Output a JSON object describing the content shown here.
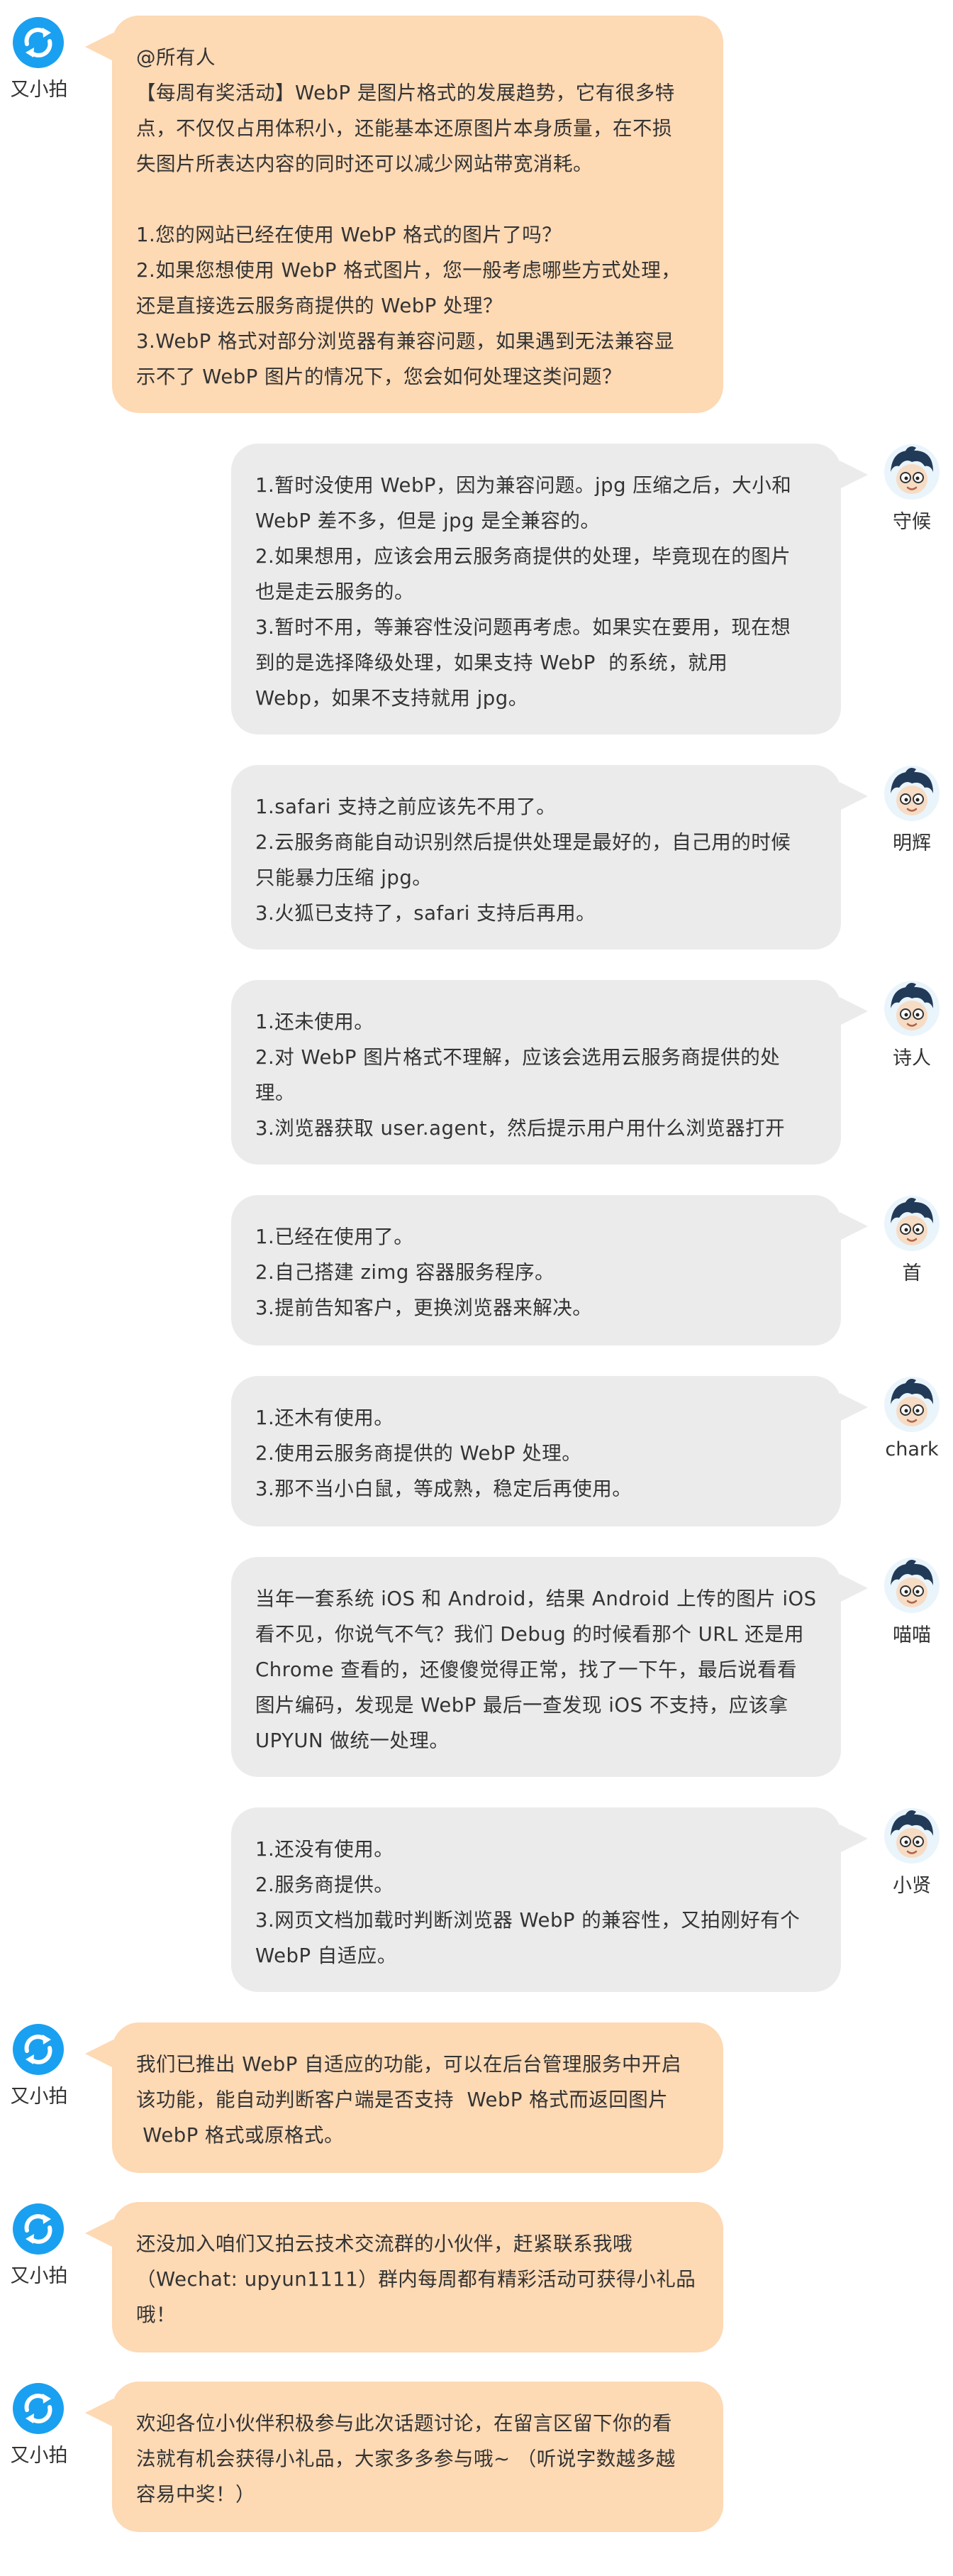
{
  "messages": [
    {
      "side": "left",
      "name": "又小拍",
      "avatar": "upyun-logo",
      "lines": [
        "@所有人",
        "【每周有奖活动】WebP 是图片格式的发展趋势，它有很多特",
        "点，不仅仅占用体积小，还能基本还原图片本身质量，在不损",
        "失图片所表达内容的同时还可以减少网站带宽消耗。",
        "",
        "1.您的网站已经在使用 WebP 格式的图片了吗？",
        "2.如果您想使用 WebP 格式图片，您一般考虑哪些方式处理，",
        "还是直接选云服务商提供的 WebP 处理？",
        "3.WebP 格式对部分浏览器有兼容问题，如果遇到无法兼容显",
        "示不了 WebP 图片的情况下，您会如何处理这类问题？"
      ]
    },
    {
      "side": "right",
      "name": "守候",
      "avatar": "cartoon-boy-avatar",
      "lines": [
        "1.暂时没使用 WebP，因为兼容问题。jpg 压缩之后，大小和",
        "WebP 差不多，但是 jpg 是全兼容的。",
        "2.如果想用，应该会用云服务商提供的处理，毕竟现在的图片",
        "也是走云服务的。",
        "3.暂时不用，等兼容性没问题再考虑。如果实在要用，现在想",
        "到的是选择降级处理，如果支持 WebP  的系统，就用",
        "Webp，如果不支持就用 jpg。"
      ]
    },
    {
      "side": "right",
      "name": "明辉",
      "avatar": "cartoon-boy-avatar",
      "lines": [
        "1.safari 支持之前应该先不用了。",
        "2.云服务商能自动识别然后提供处理是最好的，自己用的时候",
        "只能暴力压缩 jpg。",
        "3.火狐已支持了，safari 支持后再用。"
      ]
    },
    {
      "side": "right",
      "name": "诗人",
      "avatar": "cartoon-boy-avatar",
      "lines": [
        "1.还未使用。",
        "2.对 WebP 图片格式不理解，应该会选用云服务商提供的处",
        "理。",
        "3.浏览器获取 user.agent，然后提示用户用什么浏览器打开"
      ]
    },
    {
      "side": "right",
      "name": "首",
      "avatar": "cartoon-boy-avatar",
      "lines": [
        "1.已经在使用了。",
        "2.自己搭建 zimg 容器服务程序。",
        "3.提前告知客户，更换浏览器来解决。"
      ]
    },
    {
      "side": "right",
      "name": "chark",
      "avatar": "cartoon-boy-avatar",
      "lines": [
        "1.还木有使用。",
        "2.使用云服务商提供的 WebP 处理。",
        "3.那不当小白鼠，等成熟，稳定后再使用。"
      ]
    },
    {
      "side": "right",
      "name": "喵喵",
      "avatar": "cartoon-boy-avatar",
      "lines": [
        "当年一套系统 iOS 和 Android，结果 Android 上传的图片 iOS",
        "看不见，你说气不气？我们 Debug 的时候看那个 URL 还是用",
        "Chrome 查看的，还傻傻觉得正常，找了一下午，最后说看看",
        "图片编码，发现是 WebP 最后一查发现 iOS 不支持，应该拿",
        "UPYUN 做统一处理。"
      ]
    },
    {
      "side": "right",
      "name": "小贤",
      "avatar": "cartoon-boy-avatar",
      "lines": [
        "1.还没有使用。",
        "2.服务商提供。",
        "3.网页文档加载时判断浏览器 WebP 的兼容性，又拍刚好有个",
        "WebP 自适应。"
      ]
    },
    {
      "side": "left",
      "name": "又小拍",
      "avatar": "upyun-logo",
      "lines": [
        "我们已推出 WebP 自适应的功能，可以在后台管理服务中开启",
        "该功能，能自动判断客户端是否支持  WebP 格式而返回图片",
        " WebP 格式或原格式。"
      ]
    },
    {
      "side": "left",
      "name": "又小拍",
      "avatar": "upyun-logo",
      "lines": [
        "还没加入咱们又拍云技术交流群的小伙伴，赶紧联系我哦",
        "（Wechat: upyun1111）群内每周都有精彩活动可获得小礼品",
        "哦！"
      ]
    },
    {
      "side": "left",
      "name": "又小拍",
      "avatar": "upyun-logo",
      "lines": [
        "欢迎各位小伙伴积极参与此次话题讨论，在留言区留下你的看",
        "法就有机会获得小礼品，大家多多参与哦~ （听说字数越多越",
        "容易中奖！）"
      ]
    }
  ],
  "colors": {
    "left_bubble": "#fdd9b4",
    "right_bubble": "#ebebeb",
    "logo_blue": "#1aa0f0",
    "avatar_hair": "#213a58"
  }
}
